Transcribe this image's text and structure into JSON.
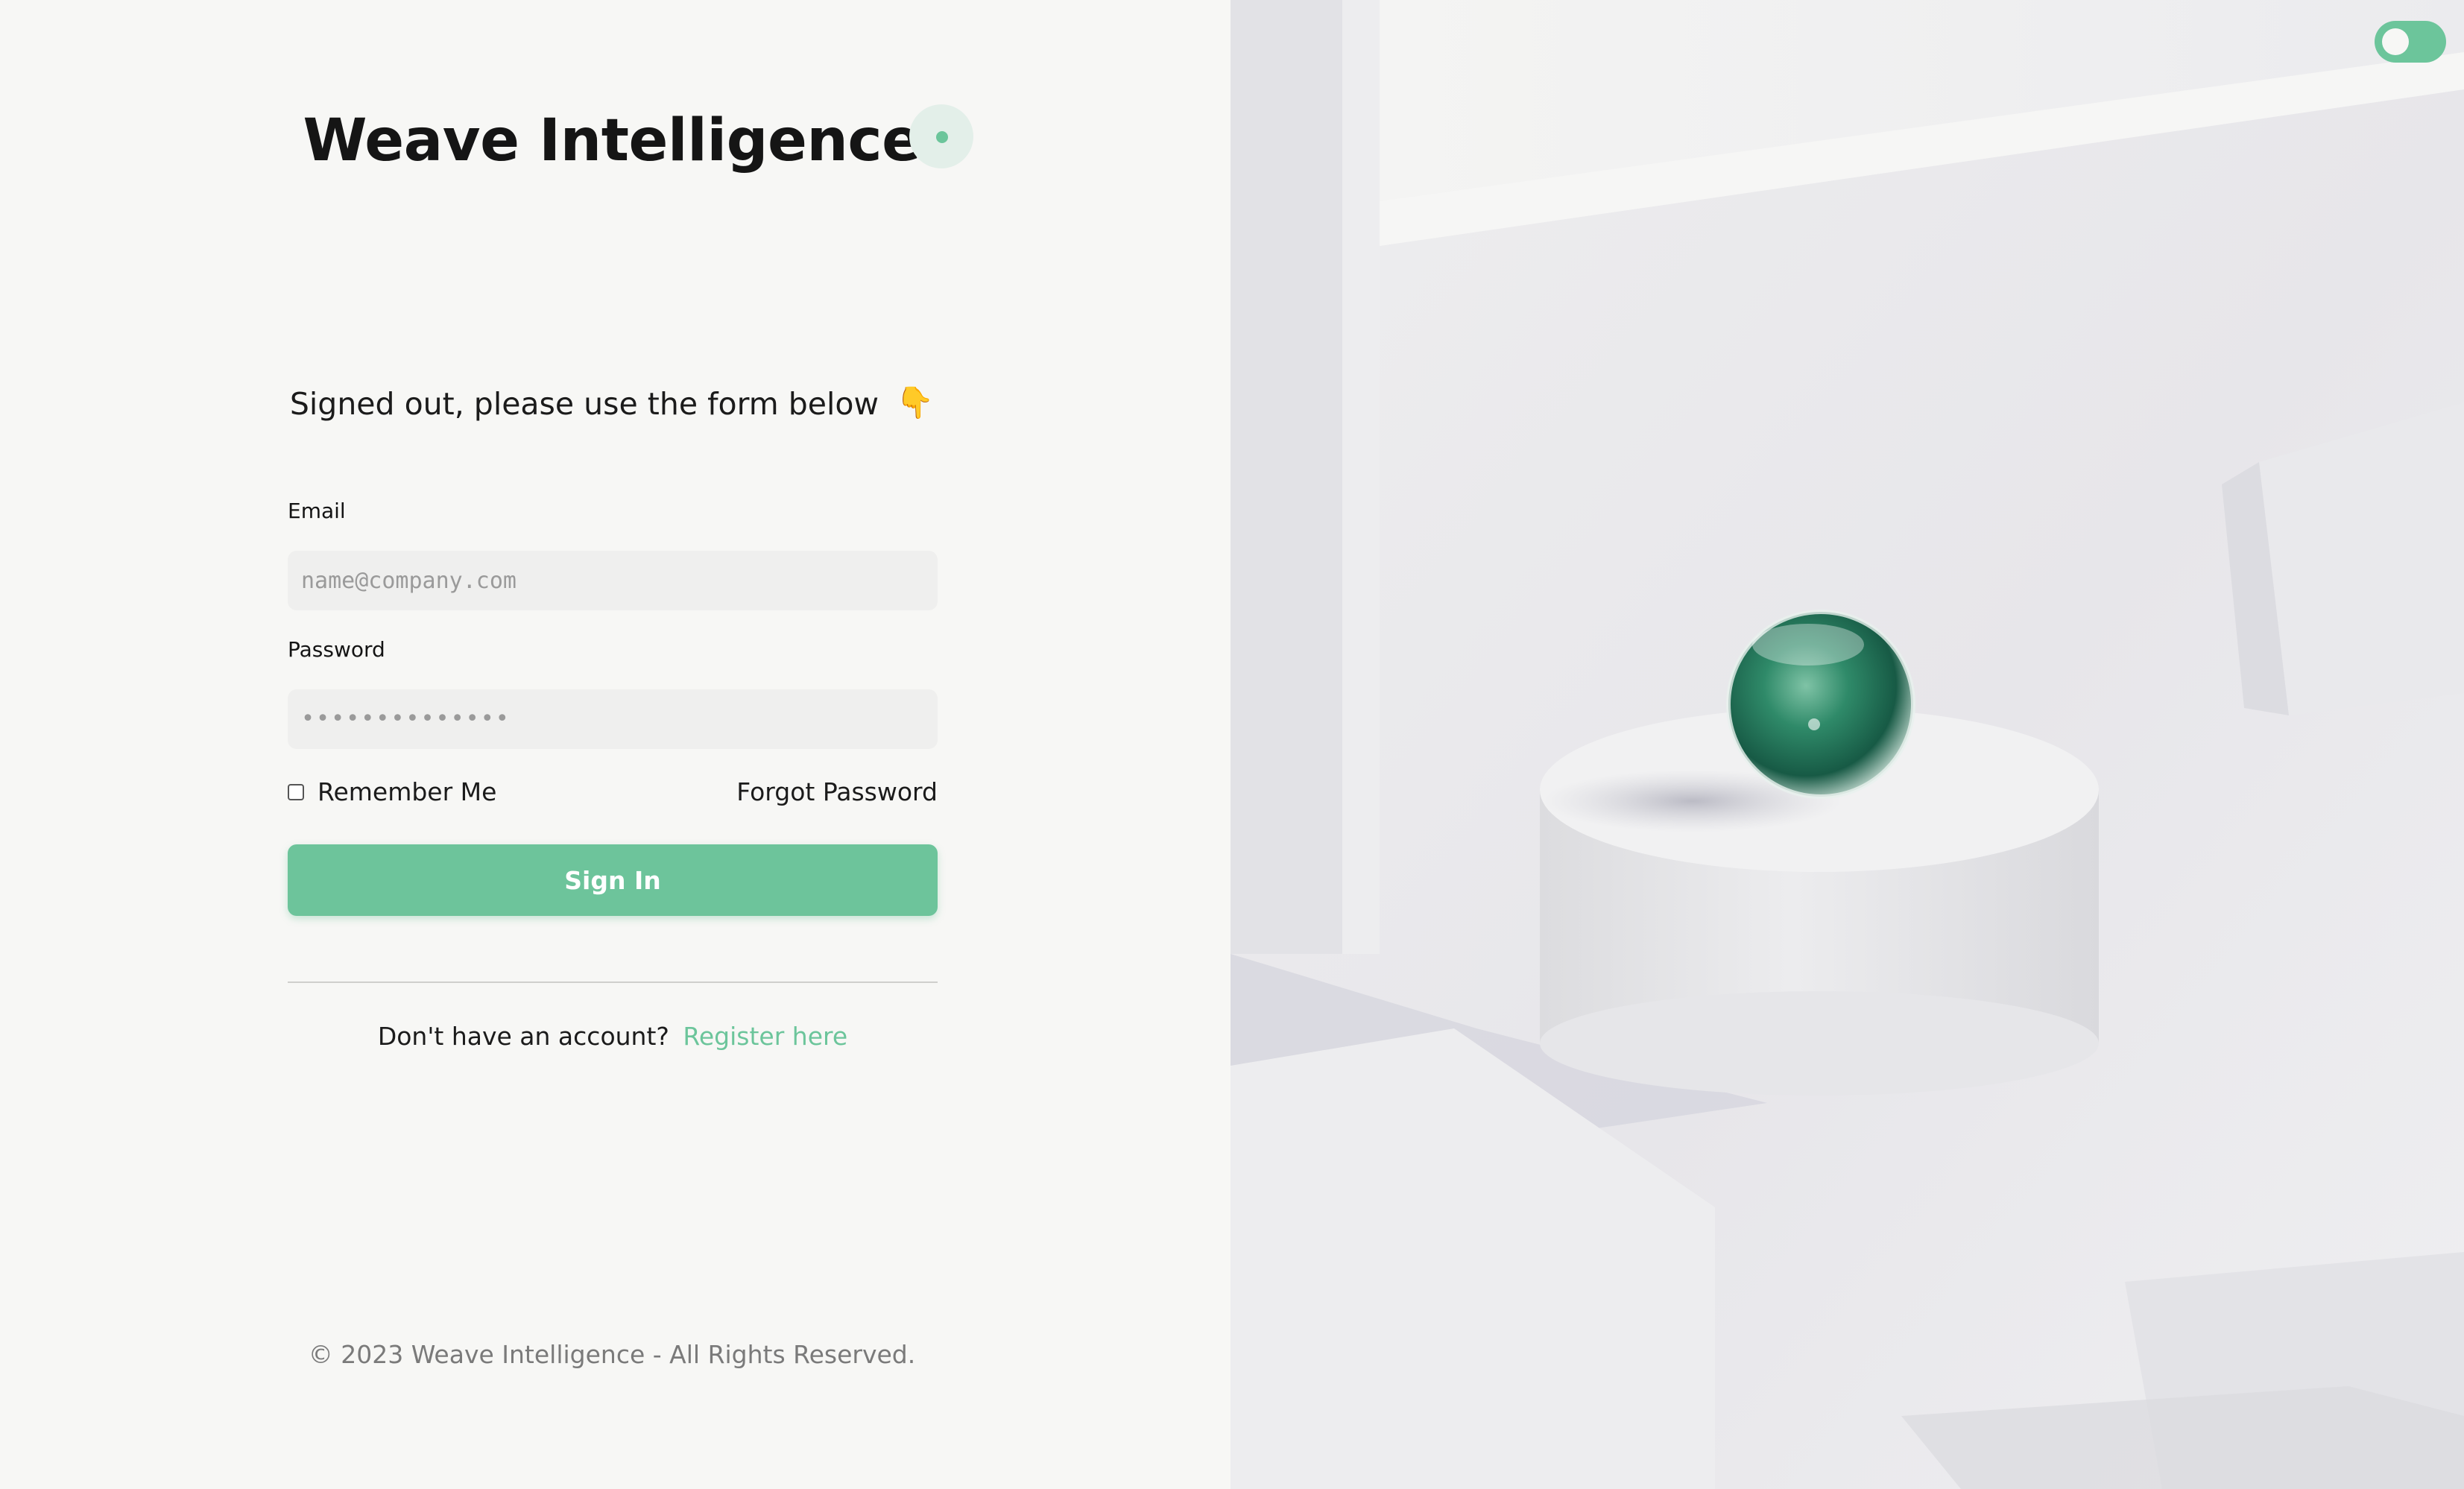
{
  "brand": {
    "name": "Weave Intelligence"
  },
  "auth": {
    "message": "Signed out, please use the form below",
    "message_icon": "👇",
    "email_label": "Email",
    "email_placeholder": "name@company.com",
    "password_label": "Password",
    "password_masked": "••••••••••••••",
    "remember_label": "Remember Me",
    "forgot_label": "Forgot Password",
    "signin_label": "Sign In",
    "register_prompt": "Don't have an account?",
    "register_link": "Register here"
  },
  "footer": {
    "text": "© 2023 Weave Intelligence - All Rights Reserved."
  },
  "theme_toggle": {
    "state": "on"
  },
  "colors": {
    "accent": "#6cc59b",
    "background": "#f7f7f5",
    "input_background": "#efefee",
    "text": "#141414",
    "muted_text": "#7a7a7a",
    "sphere": "#1f6b53"
  }
}
